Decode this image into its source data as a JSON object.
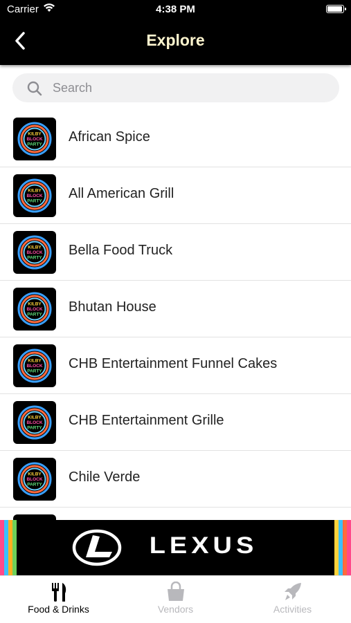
{
  "status_bar": {
    "carrier": "Carrier",
    "time": "4:38 PM"
  },
  "nav": {
    "title": "Explore"
  },
  "search": {
    "placeholder": "Search"
  },
  "vendors": [
    {
      "name": "African Spice"
    },
    {
      "name": "All American Grill"
    },
    {
      "name": "Bella Food Truck"
    },
    {
      "name": "Bhutan House"
    },
    {
      "name": "CHB Entertainment Funnel Cakes"
    },
    {
      "name": "CHB Entertainment Grille"
    },
    {
      "name": "Chile Verde"
    }
  ],
  "thumbnail_logo": {
    "icon": "kilby-block-party-logo",
    "text_lines": [
      "KILBY",
      "BLOCK",
      "PARTY"
    ]
  },
  "banner": {
    "brand": "LEXUS",
    "icon": "lexus-logo"
  },
  "tabs": [
    {
      "label": "Food & Drinks",
      "icon": "fork-knife-icon",
      "active": true
    },
    {
      "label": "Vendors",
      "icon": "shopping-bag-icon",
      "active": false
    },
    {
      "label": "Activities",
      "icon": "rocket-icon",
      "active": false
    }
  ],
  "colors": {
    "active_tab": "#000000",
    "inactive_tab": "#b8b8bc",
    "title": "#fff6cf",
    "header_bg": "#000000"
  }
}
